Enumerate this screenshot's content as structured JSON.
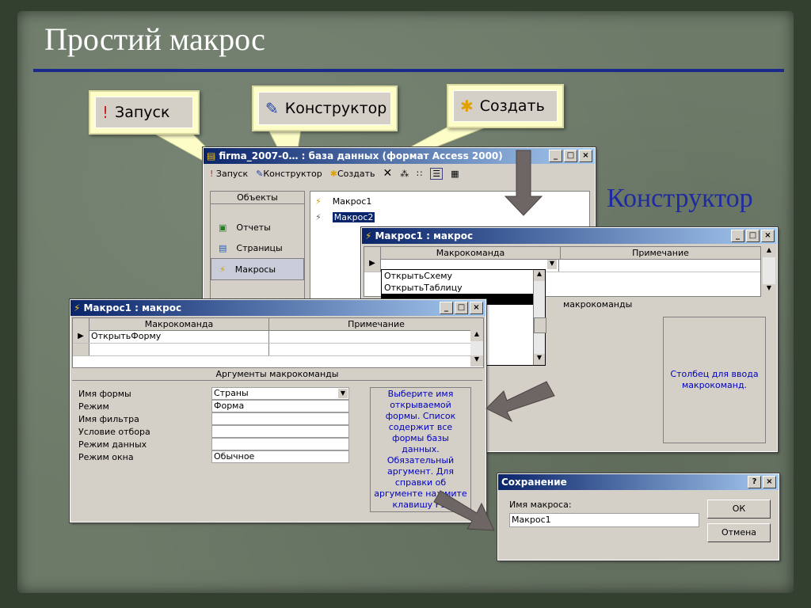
{
  "slide": {
    "title": "Простий макрос",
    "side_label": "Конструктор"
  },
  "callouts": {
    "run": "Запуск",
    "design": "Конструктор",
    "create": "Создать"
  },
  "db_window": {
    "title": "firma_2007-0… : база данных (формат Access 2000)",
    "toolbar": {
      "run": "Запуск",
      "design": "Конструктор",
      "create": "Создать"
    },
    "objects_header": "Объекты",
    "objects": [
      "Отчеты",
      "Страницы",
      "Макросы"
    ],
    "items": [
      "Макрос1",
      "Макрос2"
    ]
  },
  "macro_back": {
    "title": "Макрос1 : макрос",
    "col_command": "Макрокоманда",
    "col_note": "Примечание",
    "dropdown": [
      "ОткрытьСхему",
      "ОткрытьТаблицу"
    ],
    "args_label": "макрокоманды",
    "hint": "Столбец для ввода макрокоманд."
  },
  "macro_front": {
    "title": "Макрос1 : макрос",
    "col_command": "Макрокоманда",
    "col_note": "Примечание",
    "row1_command": "ОткрытьФорму",
    "args_header": "Аргументы макрокоманды",
    "args": [
      {
        "label": "Имя формы",
        "value": "Страны"
      },
      {
        "label": "Режим",
        "value": "Форма"
      },
      {
        "label": "Имя фильтра",
        "value": ""
      },
      {
        "label": "Условие отбора",
        "value": ""
      },
      {
        "label": "Режим данных",
        "value": ""
      },
      {
        "label": "Режим окна",
        "value": "Обычное"
      }
    ],
    "hint": "Выберите имя открываемой формы. Список содержит все формы базы данных. Обязательный аргумент. Для справки об аргументе нажмите клавишу F1."
  },
  "save_dialog": {
    "title": "Сохранение",
    "label": "Имя макроса:",
    "value": "Макрос1",
    "ok": "ОК",
    "cancel": "Отмена"
  },
  "colors": {
    "title_bar": "#0a246a",
    "hint_text": "#0000c0",
    "side_label": "#1e2aa0",
    "callout_bg": "#fdfdc8"
  }
}
